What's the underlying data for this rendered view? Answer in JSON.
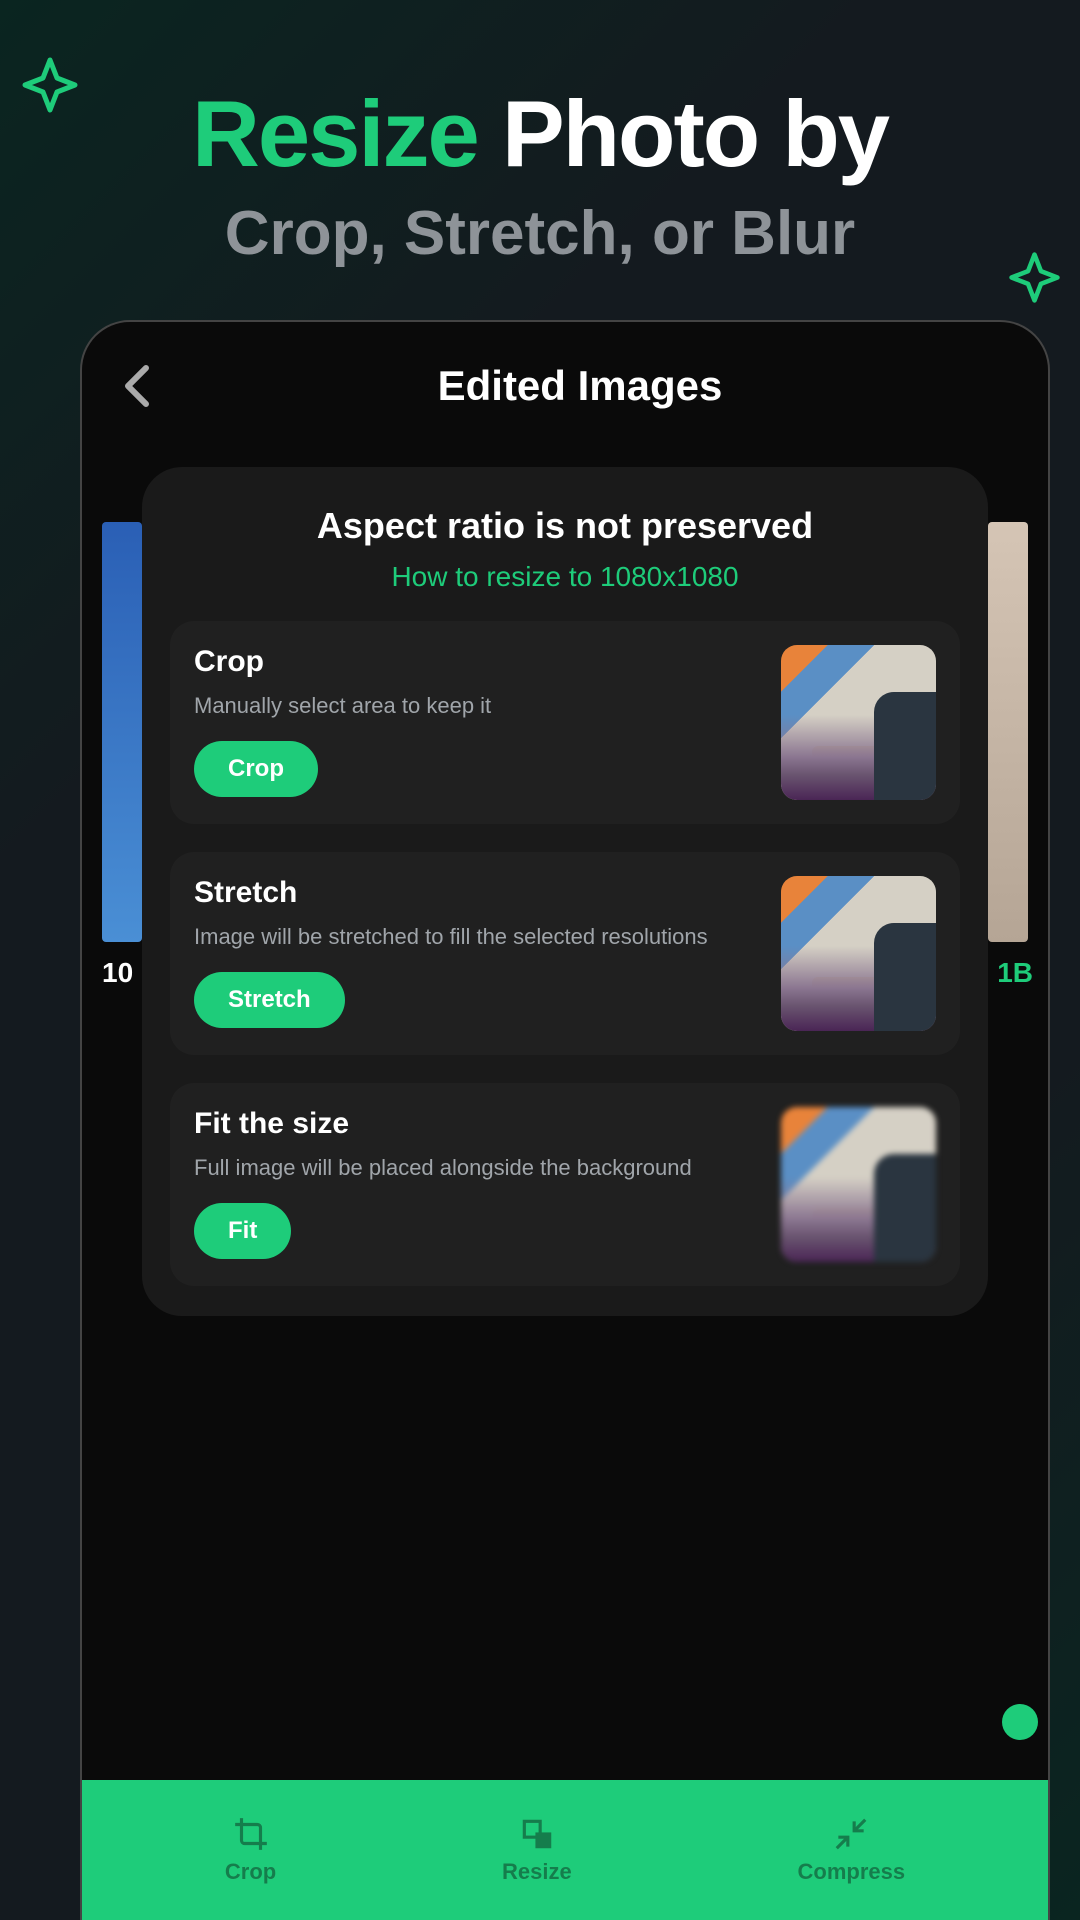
{
  "hero": {
    "accent": "Resize",
    "rest": " Photo by",
    "subtitle": "Crop, Stretch, or Blur"
  },
  "phone": {
    "title": "Edited Images",
    "bg_left": "10",
    "bg_right": "1B"
  },
  "modal": {
    "title": "Aspect ratio is not preserved",
    "subtitle": "How to resize to 1080x1080",
    "options": [
      {
        "title": "Crop",
        "desc": "Manually select area to keep it",
        "button": "Crop"
      },
      {
        "title": "Stretch",
        "desc": "Image will be stretched to fill the selected resolutions",
        "button": "Stretch"
      },
      {
        "title": "Fit the size",
        "desc": "Full image will be placed alongside the background",
        "button": "Fit"
      }
    ]
  },
  "nav": {
    "items": [
      {
        "label": "Crop"
      },
      {
        "label": "Resize"
      },
      {
        "label": "Compress"
      }
    ]
  }
}
